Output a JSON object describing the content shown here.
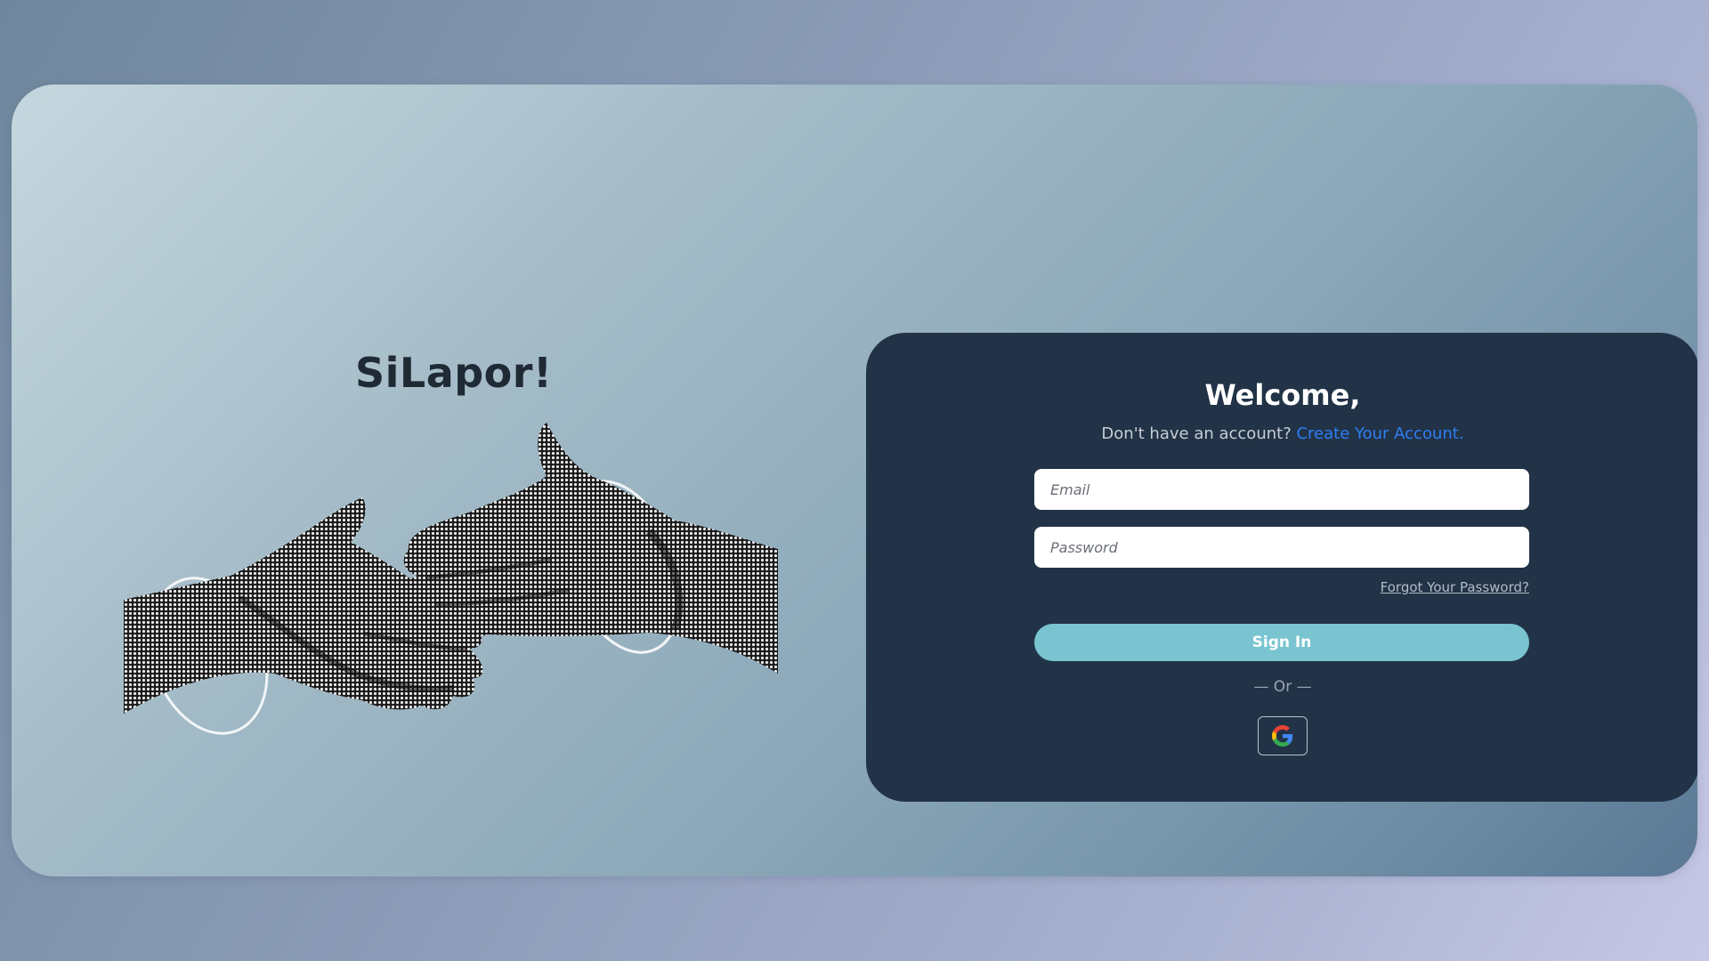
{
  "brand": {
    "title": "SiLapor!"
  },
  "illustration": {
    "name": "handshake-hands-illustration"
  },
  "login": {
    "welcome": "Welcome,",
    "no_account_text": "Don't have an account?",
    "create_account_link": "Create Your Account.",
    "email_placeholder": "Email",
    "password_placeholder": "Password",
    "email_value": "",
    "password_value": "",
    "forgot_password": "Forgot Your Password?",
    "sign_in_label": "Sign In",
    "or_divider": "— Or —",
    "google_icon": "google-icon"
  },
  "colors": {
    "panel": "#223347",
    "accent_button": "#79c4d0",
    "link": "#2f7ef5"
  }
}
